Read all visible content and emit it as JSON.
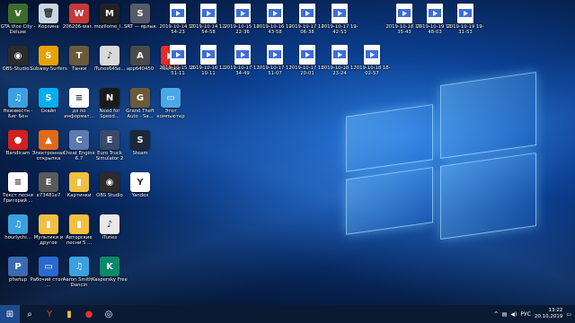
{
  "desktop_icons": [
    {
      "label": "GTA Vice City - Deluxe",
      "color": "#3a6d2a",
      "glyph": "V"
    },
    {
      "label": "Корзина",
      "color": "#c9d6e3",
      "glyph": "🗑"
    },
    {
      "label": "206206-war...",
      "color": "#c43a3a",
      "glyph": "W"
    },
    {
      "label": "mozilome_l...",
      "color": "#222222",
      "glyph": "M"
    },
    {
      "label": "SRT — ярлык",
      "color": "#555b66",
      "glyph": "S"
    },
    {
      "label": "OBS-Studio...",
      "color": "#2b2b2b",
      "glyph": "◉"
    },
    {
      "label": "Subway Surfers",
      "color": "#e8a200",
      "glyph": "S"
    },
    {
      "label": "Танки",
      "color": "#6a5a3a",
      "glyph": "T"
    },
    {
      "label": "iTunes64Se...",
      "color": "#d9d9d9",
      "glyph": "♪"
    },
    {
      "label": "app640450",
      "color": "#4a4a4a",
      "glyph": "A"
    },
    {
      "label": "YouTube",
      "color": "#e52d27",
      "glyph": "▶"
    },
    {
      "label": "Неизвестн - Биг Бен",
      "color": "#3aa0e0",
      "glyph": "♫"
    },
    {
      "label": "Скайп",
      "color": "#00aff0",
      "glyph": "S"
    },
    {
      "label": "дз по информат...",
      "color": "#ffffff",
      "glyph": "≡"
    },
    {
      "label": "Need for Speed...",
      "color": "#1a1a1a",
      "glyph": "N"
    },
    {
      "label": "Grand Theft Auto - Sa...",
      "color": "#6d5a3a",
      "glyph": "G"
    },
    {
      "label": "Этот компьютер",
      "color": "#4aa8e8",
      "glyph": "▭"
    },
    {
      "label": "Bandicam",
      "color": "#d02020",
      "glyph": "●"
    },
    {
      "label": "Электронная открытка",
      "color": "#e06a1a",
      "glyph": "▲"
    },
    {
      "label": "Cheat Engine 6.7",
      "color": "#5a7ab0",
      "glyph": "C"
    },
    {
      "label": "Euro Truck Simulator 2",
      "color": "#3a4a6a",
      "glyph": "E"
    },
    {
      "label": "Steam",
      "color": "#1b2838",
      "glyph": "S"
    },
    {
      "label": "Текст песни Григорий ...",
      "color": "#ffffff",
      "glyph": "≡"
    },
    {
      "label": "e73481e7",
      "color": "#5a5a5a",
      "glyph": "E"
    },
    {
      "label": "Картинки",
      "color": "#f0c040",
      "glyph": "▮"
    },
    {
      "label": "OBS Studio",
      "color": "#2b2b2b",
      "glyph": "◉"
    },
    {
      "label": "Yandex",
      "color": "#ffffff",
      "glyph": "Y"
    },
    {
      "label": "hourlychi...",
      "color": "#3aa0e0",
      "glyph": "♫"
    },
    {
      "label": "Мультики и другое",
      "color": "#f0c040",
      "glyph": "▮"
    },
    {
      "label": "Авторские песни 5 ...",
      "color": "#f0c040",
      "glyph": "▮"
    },
    {
      "label": "iTunes",
      "color": "#e8e8e8",
      "glyph": "♪"
    },
    {
      "label": "pfsetup",
      "color": "#3a6ab0",
      "glyph": "P"
    },
    {
      "label": "Рабочий стол - ...",
      "color": "#2a6ad0",
      "glyph": "▭"
    },
    {
      "label": "Aaron Smith - Dancin",
      "color": "#3aa0e0",
      "glyph": "♫"
    },
    {
      "label": "Kaspersky Free",
      "color": "#0a8a6a",
      "glyph": "K"
    }
  ],
  "video_files": [
    {
      "label": "2019-10-14 17-54-23"
    },
    {
      "label": "2019-10-14 12-54-58"
    },
    {
      "label": "2019-10-15 18-22-36"
    },
    {
      "label": "2019-10-16 19-43-58"
    },
    {
      "label": "2019-10-17 14-06-38"
    },
    {
      "label": "2019-10-17 19-42-53"
    },
    {
      "label": "2019-10-18 19-35-43"
    },
    {
      "label": "2019-10-19 11-48-03"
    },
    {
      "label": "2019-10-19 19-31-53"
    },
    {
      "label": "2019-10-15 18-51-11"
    },
    {
      "label": "2019-10-16 12-10-11"
    },
    {
      "label": "2019-10-17 17-34-49"
    },
    {
      "label": "2019-10-17 17-51-07"
    },
    {
      "label": "2019-10-17 18-20-01"
    },
    {
      "label": "2019-10-18 12-23-24"
    },
    {
      "label": "2019-10-18 18-02-57"
    }
  ],
  "taskbar": {
    "items": [
      "start",
      "search",
      "yandex",
      "explorer",
      "camera",
      "media"
    ],
    "tray": {
      "language": "РУС",
      "time": "13:22",
      "date": "20.10.2019"
    }
  }
}
